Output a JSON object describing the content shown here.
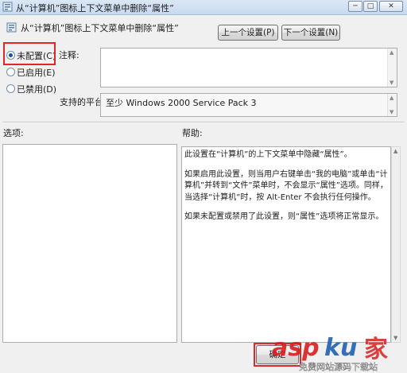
{
  "window": {
    "title": "从“计算机”图标上下文菜单中删除“属性”",
    "controls": {
      "minimize": "─",
      "maximize": "□",
      "close": "✕"
    }
  },
  "header": {
    "title": "从“计算机”图标上下文菜单中删除“属性”",
    "prev_button": "上一个设置(P)",
    "next_button": "下一个设置(N)"
  },
  "state": {
    "options": [
      {
        "label": "未配置(C)",
        "selected": true
      },
      {
        "label": "已启用(E)",
        "selected": false
      },
      {
        "label": "已禁用(D)",
        "selected": false
      }
    ]
  },
  "comment": {
    "label": "注释:",
    "value": ""
  },
  "platform": {
    "label": "支持的平台:",
    "value": "至少 Windows 2000 Service Pack 3"
  },
  "options_pane": {
    "label": "选项:"
  },
  "help": {
    "label": "帮助:",
    "paragraphs": [
      "此设置在“计算机”的上下文菜单中隐藏“属性”。",
      "如果启用此设置，则当用户右键单击“我的电脑”或单击“计算机”并转到“文件”菜单时，不会显示“属性”选项。同样，当选择“计算机”时，按 Alt-Enter 不会执行任何操作。",
      "如果未配置或禁用了此设置，则“属性”选项将正常显示。"
    ]
  },
  "footer": {
    "ok_button": "确定"
  },
  "watermark": {
    "brand": "asp",
    "brand2": "ku",
    "brand3": "家",
    "sub": "免费网站源码下载站"
  },
  "colors": {
    "highlight": "#e0262a",
    "watermark_red": "#d81e1e",
    "watermark_blue": "#1f5fb0"
  },
  "icons": {
    "policy": "policy-setting-icon"
  }
}
